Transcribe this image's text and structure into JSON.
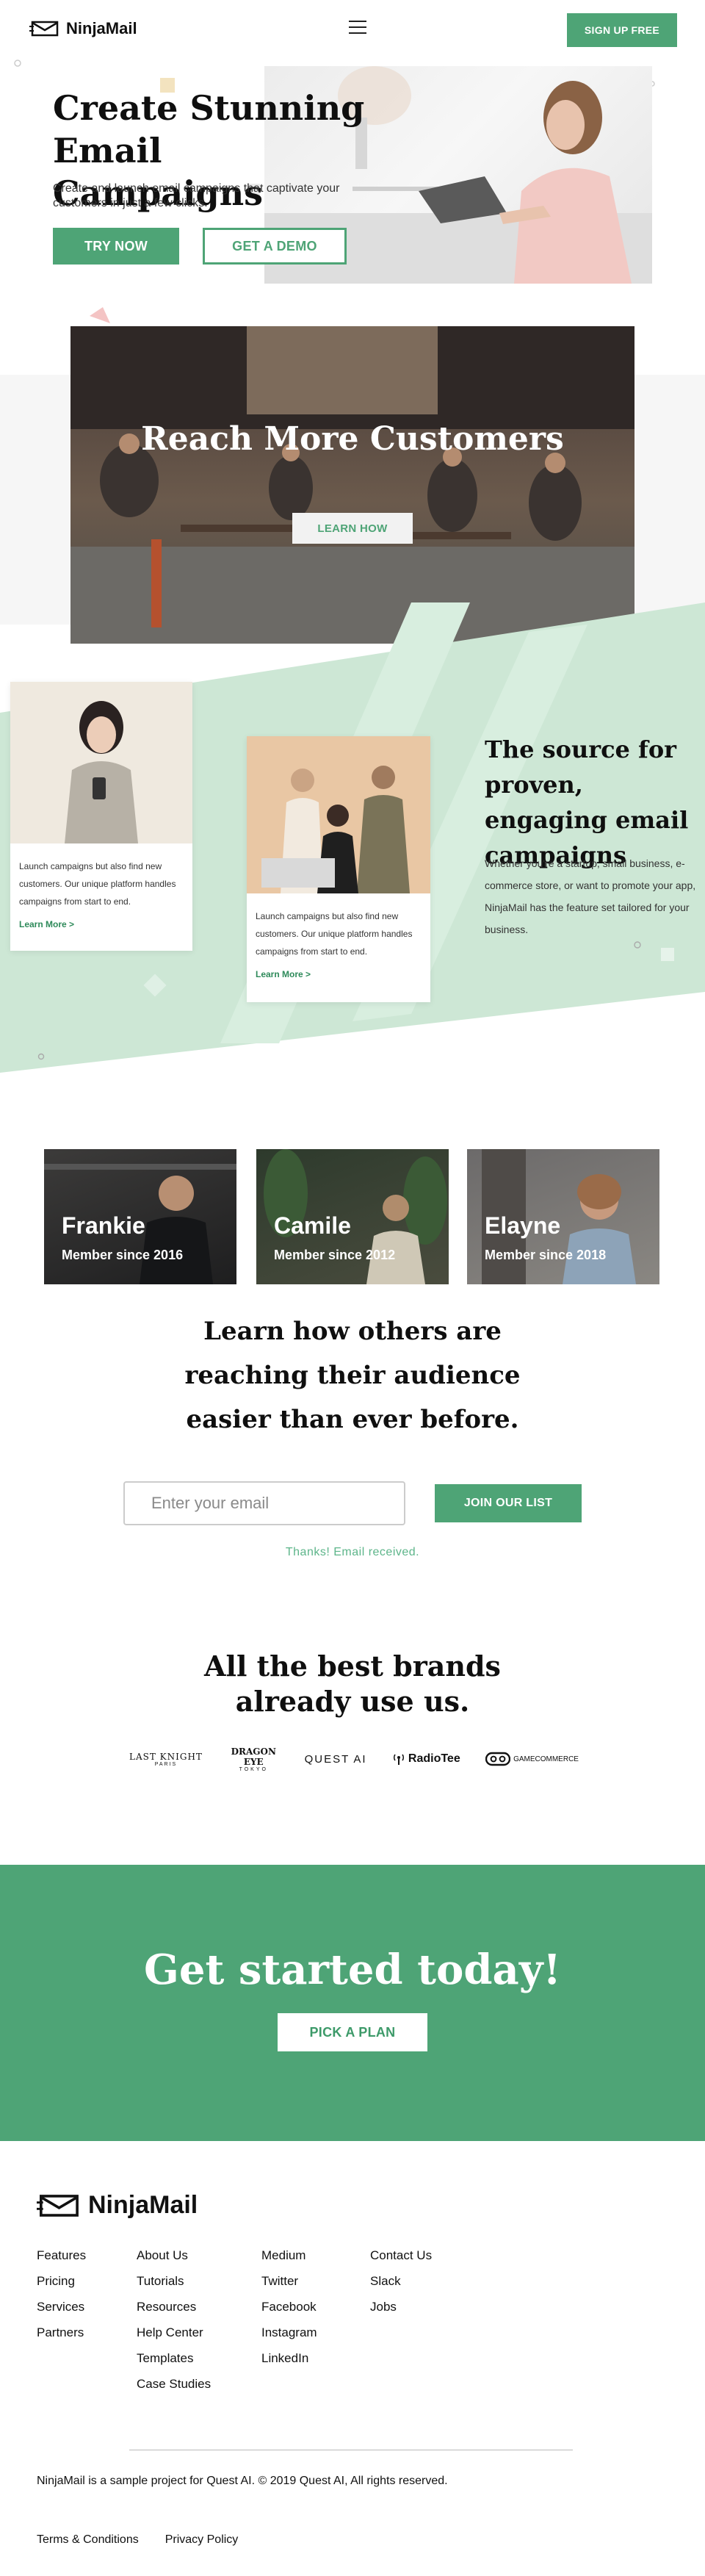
{
  "header": {
    "brand": "NinjaMail",
    "logo_icon": "envelope-icon",
    "menu_icon": "hamburger-icon",
    "signup_label": "SIGN UP FREE"
  },
  "hero": {
    "title_line1": "Create Stunning",
    "title_line2": "Email Campaigns",
    "subtitle": "Create and launch email campaigns that captivate your customers in just a few clicks.",
    "try_label": "TRY NOW",
    "demo_label": "GET A DEMO",
    "image": "woman-working-on-laptop"
  },
  "reach": {
    "title": "Reach More Customers",
    "learn_label": "LEARN HOW",
    "image": "busy-street-cafe"
  },
  "source": {
    "cards": [
      {
        "text": "Launch campaigns but also find new customers. Our unique platform handles campaigns from start to end.",
        "link": "Learn More >",
        "image": "woman-holding-phone"
      },
      {
        "text": "Launch campaigns but also find new customers. Our unique platform handles campaigns from start to end.",
        "link": "Learn More >",
        "image": "team-around-laptop"
      }
    ],
    "title": "The source for proven, engaging email campaigns",
    "text": "Whether you're a startup, small business, e-commerce store, or want to promote your app, NinjaMail has the feature set tailored for your business."
  },
  "members": [
    {
      "name": "Frankie",
      "since": "Member since 2016"
    },
    {
      "name": "Camile",
      "since": "Member since 2012"
    },
    {
      "name": "Elayne",
      "since": "Member since 2018"
    }
  ],
  "signup": {
    "title": "Learn how others are reaching their audience easier than ever before.",
    "email_placeholder": "Enter your email",
    "join_label": "JOIN OUR LIST",
    "thanks": "Thanks! Email received."
  },
  "brands": {
    "title_line1": "All the best brands",
    "title_line2": "already use us.",
    "items": [
      {
        "name": "LAST KNIGHT",
        "sub": "PARIS"
      },
      {
        "name": "DRAGON EYE",
        "sub": "TOKYO"
      },
      {
        "name": "QUEST AI",
        "sub": ""
      },
      {
        "name": "RadioTee",
        "sub": ""
      },
      {
        "name": "GAMECOMMERCE",
        "sub": ""
      }
    ]
  },
  "cta": {
    "title": "Get started today!",
    "plan_label": "PICK A PLAN"
  },
  "footer": {
    "brand": "NinjaMail",
    "col1": [
      "Features",
      "Pricing",
      "Services",
      "Partners"
    ],
    "col2": [
      "About Us",
      "Tutorials",
      "Resources",
      "Help Center",
      "Templates",
      "Case Studies"
    ],
    "col3": [
      "Medium",
      "Twitter",
      "Facebook",
      "Instagram",
      "LinkedIn"
    ],
    "col4": [
      "Contact Us",
      "Slack",
      "Jobs"
    ],
    "copyright": "NinjaMail is a sample project for Quest AI. © 2019 Quest AI, All rights reserved.",
    "terms": "Terms & Conditions",
    "privacy": "Privacy Policy"
  },
  "colors": {
    "accent": "#4ea476",
    "accent_light": "#cde7d5",
    "text_dark": "#0f0f0f"
  }
}
